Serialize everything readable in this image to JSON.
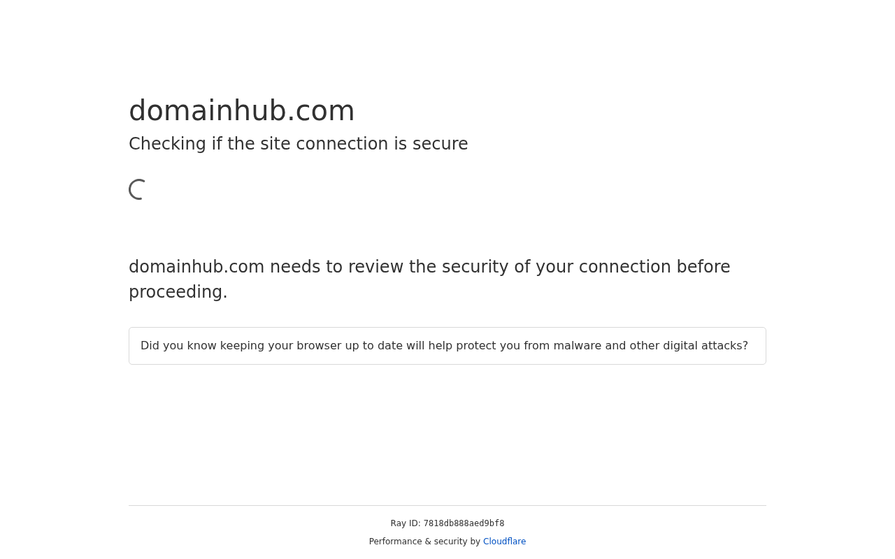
{
  "header": {
    "title": "domainhub.com",
    "subtitle": "Checking if the site connection is secure"
  },
  "message": "domainhub.com needs to review the security of your connection before proceeding.",
  "tip": "Did you know keeping your browser up to date will help protect you from malware and other digital attacks?",
  "footer": {
    "ray_id_label": "Ray ID:",
    "ray_id": "7818db888aed9bf8",
    "credit": "Performance & security by",
    "link": "Cloudflare"
  }
}
